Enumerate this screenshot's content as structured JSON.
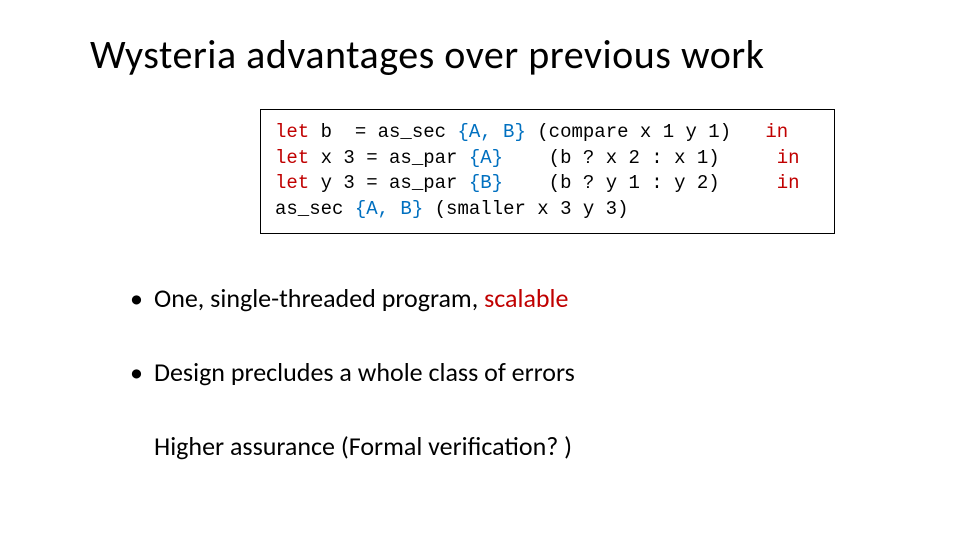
{
  "title": "Wysteria advantages over previous work",
  "code": {
    "l1": {
      "let": "let",
      "a": " b  = as_sec ",
      "set": "{A, B}",
      "b": " (compare x 1 y 1)   ",
      "in": "in"
    },
    "l2": {
      "let": "let",
      "a": " x 3 = as_par ",
      "set": "{A}",
      "b": "    (b ? x 2 : x 1)     ",
      "in": "in"
    },
    "l3": {
      "let": "let",
      "a": " y 3 = as_par ",
      "set": "{B}",
      "b": "    (b ? y 1 : y 2)     ",
      "in": "in"
    },
    "l4": {
      "a": "as_sec ",
      "set": "{A, B}",
      "b": " (smaller x 3 y 3)"
    }
  },
  "bullets": [
    {
      "pre": "One, single-threaded program, ",
      "accent": "scalable"
    },
    {
      "pre": "Design precludes a whole class of errors"
    }
  ],
  "sub": "Higher assurance (Formal verification? )"
}
